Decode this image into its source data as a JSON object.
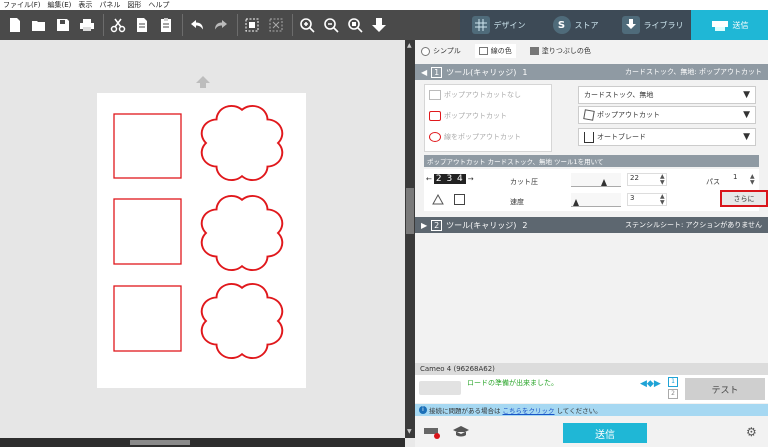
{
  "menu": [
    "ファイル(F)",
    "編集(E)",
    "表示",
    "パネル",
    "図形",
    "ヘルプ"
  ],
  "tabs": [
    {
      "label": "デザイン",
      "icon": "grid-icon"
    },
    {
      "label": "ストア",
      "icon": "store-s-icon"
    },
    {
      "label": "ライブラリ",
      "icon": "download-icon"
    },
    {
      "label": "送信",
      "icon": "plotter-icon"
    }
  ],
  "panel": {
    "modes": [
      "シンプル",
      "線の色",
      "塗りつぶしの色"
    ],
    "tool1": {
      "header": "ツール(キャリッジ)",
      "num": "1",
      "sub": "1",
      "right": "カードストック、無地: ポップアウトカット"
    },
    "actions": [
      "ポップアウトカットなし",
      "ポップアウトカット",
      "線をポップアウトカット"
    ],
    "material": "カードストック、無地",
    "action": "ポップアウトカット",
    "tool": "オートブレード",
    "info": "ポップアウトカット カードストック、無地 ツール1を用いて",
    "blade_digits": "2 3 4",
    "cut_pressure_label": "カット圧",
    "cut_pressure": "22",
    "pass_label": "パス",
    "pass": "1",
    "speed_label": "速度",
    "speed": "3",
    "more_button": "さらに",
    "tool2": {
      "header": "ツール(キャリッジ)",
      "num": "2",
      "sub": "2",
      "right": "ステンシルシート: アクションがありません"
    },
    "device": "Cameo 4 (96268A62)",
    "status": "ロードの準備が出来ました。",
    "test_button": "テスト",
    "help_pre": "接続に問題がある場合は",
    "help_link": "こちらをクリック",
    "help_post": "してください。",
    "send_button": "送信",
    "pages": [
      "1",
      "2"
    ]
  },
  "colors": {
    "accent": "#1fb7d6",
    "cut_line": "#e0181c",
    "highlight": "#d9141a"
  }
}
